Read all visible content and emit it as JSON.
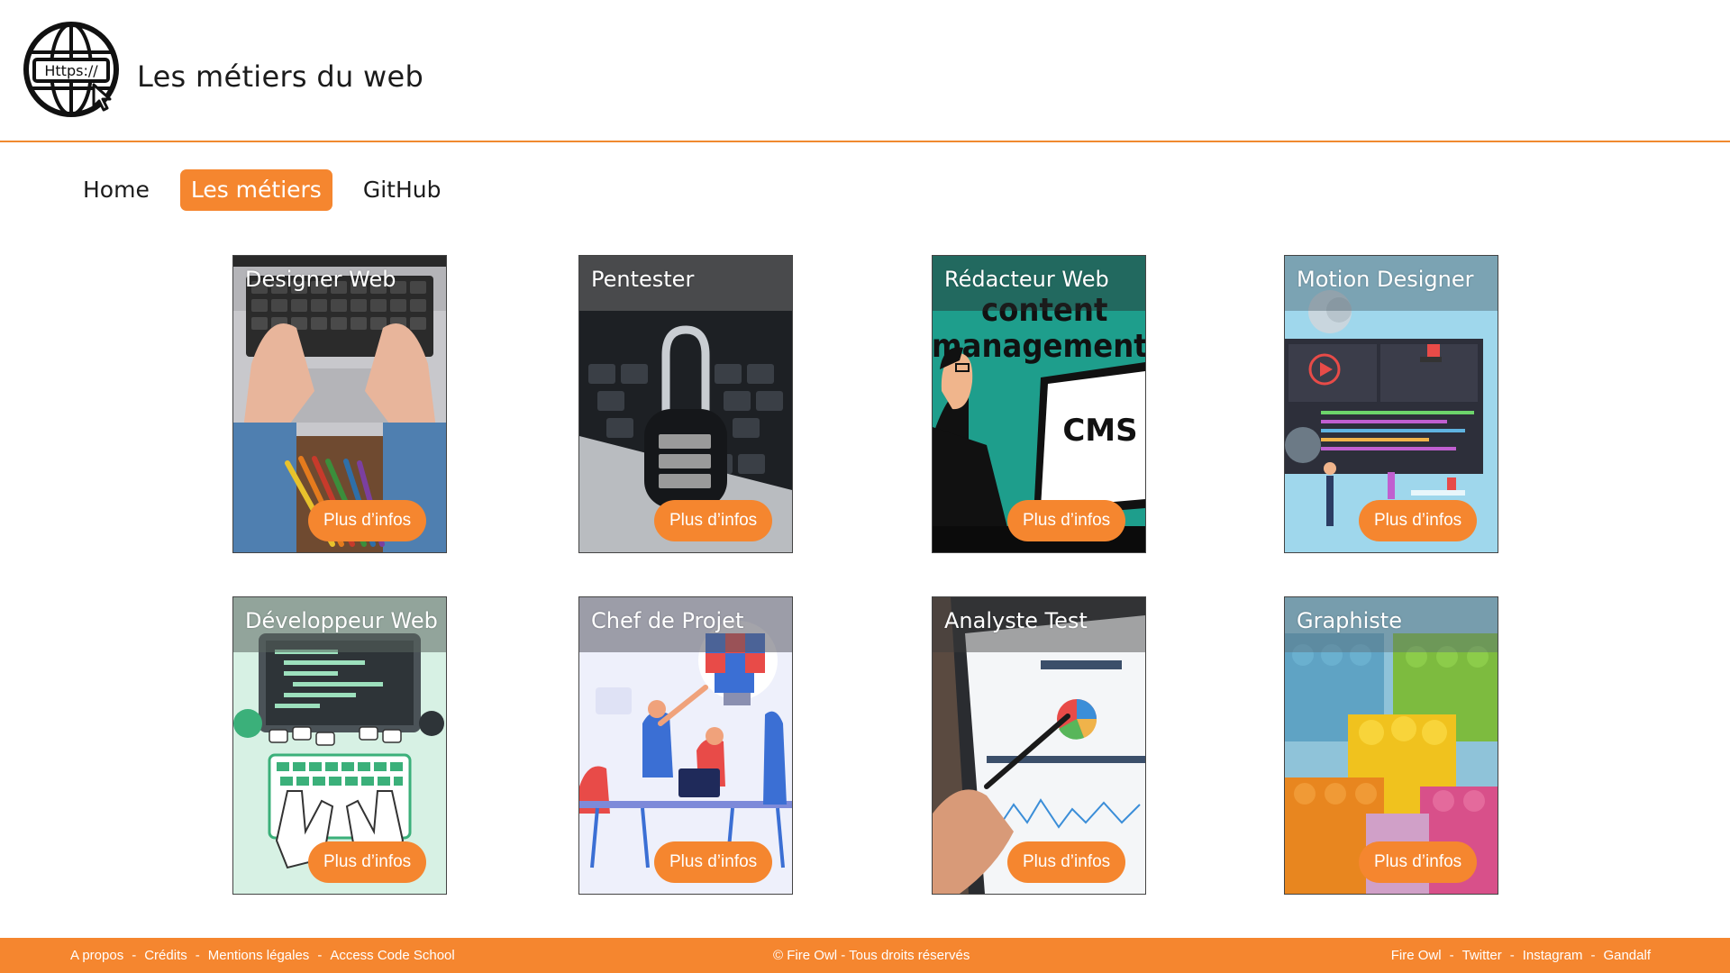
{
  "header": {
    "logo_text": "Https://",
    "title": "Les métiers du web"
  },
  "nav": {
    "items": [
      {
        "label": "Home",
        "active": false
      },
      {
        "label": "Les métiers",
        "active": true
      },
      {
        "label": "GitHub",
        "active": false
      }
    ]
  },
  "cards": [
    {
      "title": "Designer Web",
      "button": "Plus d’infos"
    },
    {
      "title": "Pentester",
      "button": "Plus d’infos"
    },
    {
      "title": "Rédacteur Web",
      "button": "Plus d’infos",
      "art_text": [
        "content",
        "management",
        "CMS"
      ]
    },
    {
      "title": "Motion Designer",
      "button": "Plus d’infos"
    },
    {
      "title": "Développeur Web",
      "button": "Plus d’infos"
    },
    {
      "title": "Chef de Projet",
      "button": "Plus d’infos"
    },
    {
      "title": "Analyste Test",
      "button": "Plus d’infos"
    },
    {
      "title": "Graphiste",
      "button": "Plus d’infos"
    }
  ],
  "footer": {
    "left_links": [
      "A propos",
      "Crédits",
      "Mentions légales",
      "Access Code School"
    ],
    "separator": "-",
    "center": "© Fire Owl - Tous droits réservés",
    "right_links": [
      "Fire Owl",
      "Twitter",
      "Instagram",
      "Gandalf"
    ]
  },
  "colors": {
    "accent": "#f5862f",
    "header_rule": "#f0892f",
    "text": "#1b1b1b"
  },
  "icons": [
    "globe-cursor-logo-icon"
  ]
}
